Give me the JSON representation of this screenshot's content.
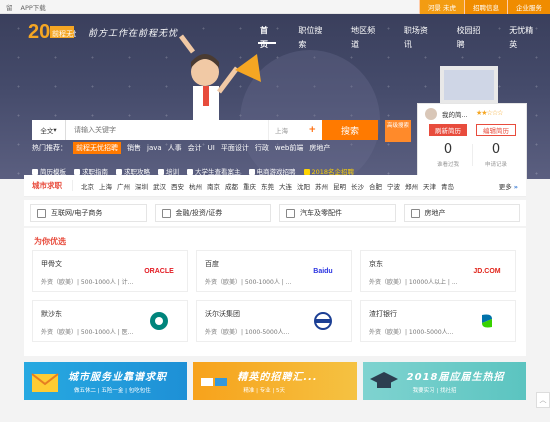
{
  "topbar": {
    "left_items": [
      "留",
      "APP下载"
    ],
    "username": "河景 未虎",
    "links": [
      "招聘信息",
      "企业服务"
    ]
  },
  "brand": {
    "logo_text": "前程无忧",
    "anniversary": "20",
    "slogan": "前方工作在前程无忧"
  },
  "nav": [
    "首页",
    "职位搜索",
    "地区频道",
    "职场资讯",
    "校园招聘",
    "无忧精英"
  ],
  "search": {
    "type": "全文",
    "placeholder": "请输入关键字",
    "city": "上海",
    "button": "搜索",
    "advanced": "高级搜索"
  },
  "hot": {
    "label": "热门推荐：",
    "tag": "前程无忧招聘",
    "items": [
      "销售",
      "java",
      "人事",
      "会计",
      "UI",
      "平面设计",
      "行政",
      "web前端",
      "房地产"
    ]
  },
  "tools": [
    "简历模板",
    "求职指南",
    "求职攻略",
    "培训",
    "大学生查看案主",
    "电商游戏招聘",
    "2018名企招聘"
  ],
  "user_card": {
    "greeting": "我的简...",
    "stars": "★★☆☆☆",
    "refresh": "刷新简历",
    "edit": "编辑简历",
    "viewed_count": "0",
    "viewed_label": "谁看过我",
    "applied_count": "0",
    "applied_label": "申请记录"
  },
  "city_section": {
    "title": "城市求职",
    "cities": [
      "北京",
      "上海",
      "广州",
      "深圳",
      "武汉",
      "西安",
      "杭州",
      "南京",
      "成都",
      "重庆",
      "东莞",
      "大连",
      "沈阳",
      "苏州",
      "昆明",
      "长沙",
      "合肥",
      "宁波",
      "郑州",
      "天津",
      "青岛"
    ],
    "more": "更多"
  },
  "industries": [
    "互联网/电子商务",
    "金融/投资/证券",
    "汽车及零配件",
    "房地产"
  ],
  "picks": {
    "title": "为你优选",
    "companies": [
      {
        "name": "甲骨文",
        "desc": "外资（欧美）| 500-1000人 | 计...",
        "logo": "ORACLE"
      },
      {
        "name": "百度",
        "desc": "外资（欧美）| 500-1000人 | ...",
        "logo": "Baidu"
      },
      {
        "name": "京东",
        "desc": "外资（欧美）| 10000人以上 | ...",
        "logo": "JD.COM"
      },
      {
        "name": "默沙东",
        "desc": "外资（欧美）| 500-1000人 | 医...",
        "logo": "MSD"
      },
      {
        "name": "沃尔沃集团",
        "desc": "外资（欧美）| 1000-5000人...",
        "logo": "VOLVO"
      },
      {
        "name": "渣打银行",
        "desc": "外资（欧美）| 1000-5000人...",
        "logo": "SC"
      }
    ]
  },
  "banners": [
    {
      "title": "城市服务业靠谱求职",
      "sub": "做五休二 | 五险一金 | 包吃包住"
    },
    {
      "title": "精英的招聘汇...",
      "sub": "精准 | 专业 | 5天"
    },
    {
      "title": "2018届应届生热招",
      "sub": "我要实习 | 找社招"
    }
  ]
}
